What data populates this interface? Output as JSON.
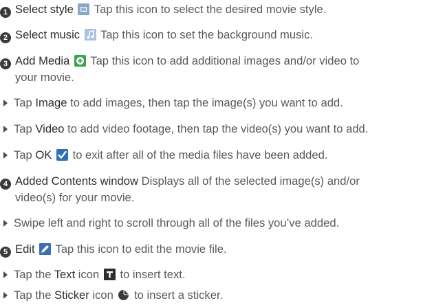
{
  "colors": {
    "text": "#58595b",
    "emphasis": "#2e2e2e",
    "number_badge": "#3a3a3a",
    "style_icon": "#8aa7c8",
    "music_icon": "#a8c3e0",
    "add_icon": "#3fa24a",
    "ok_icon": "#2f6fb5",
    "edit_icon": "#3b6fb3",
    "text_icon": "#2d2d2d",
    "sticker_icon": "#3a3a3a"
  },
  "items": [
    {
      "num": "1",
      "title": "Select style",
      "icon": "movie-style-icon",
      "desc": "Tap this icon to select the desired movie style."
    },
    {
      "num": "2",
      "title": "Select music",
      "icon": "music-note-icon",
      "desc": "Tap this icon to set the background music."
    },
    {
      "num": "3",
      "title": "Add Media",
      "icon": "add-media-icon",
      "desc": "Tap this icon to add additional images and/or video to",
      "desc2": "your movie."
    },
    {
      "num": "4",
      "title": "Added Contents window",
      "desc": "Displays all of the selected image(s) and/or",
      "desc2": "video(s) for your movie."
    },
    {
      "num": "5",
      "title": "Edit",
      "icon": "pencil-edit-icon",
      "desc": "Tap this icon to edit the movie file."
    }
  ],
  "subs": {
    "image": {
      "pre": "Tap ",
      "bold": "Image",
      "post": " to add images, then tap the image(s) you want to add."
    },
    "video": {
      "pre": "Tap ",
      "bold": "Video",
      "post": " to add video footage, then tap the video(s) you want to add."
    },
    "ok": {
      "pre": "Tap ",
      "bold": "OK",
      "icon": "checkmark-icon",
      "post": " to exit after all of the media files have been added."
    },
    "swipe": {
      "pre": "Swipe left and right to scroll through all of the files you’ve added."
    },
    "text": {
      "pre": "Tap the ",
      "bold": "Text",
      "mid": " icon",
      "icon": "text-t-icon",
      "post": " to insert text."
    },
    "sticker": {
      "pre": "Tap the ",
      "bold": "Sticker",
      "mid": " icon",
      "icon": "sticker-icon",
      "post": " to insert a sticker."
    }
  }
}
